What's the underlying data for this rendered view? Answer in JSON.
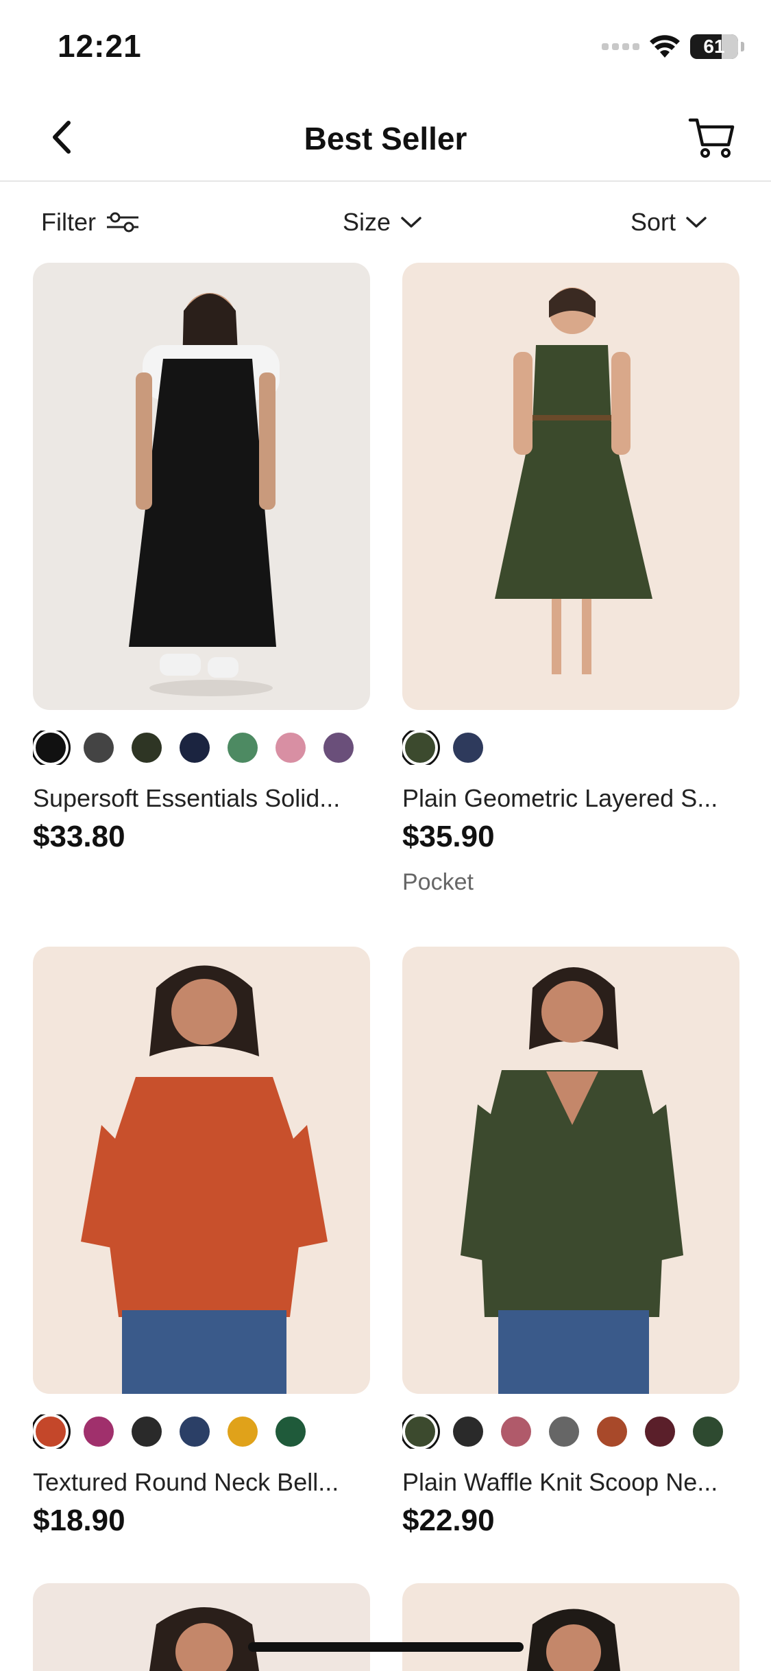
{
  "status": {
    "time": "12:21",
    "battery": "61"
  },
  "nav": {
    "title": "Best Seller"
  },
  "filters": {
    "filter_label": "Filter",
    "size_label": "Size",
    "sort_label": "Sort"
  },
  "products": [
    {
      "name": "Supersoft Essentials Solid...",
      "price": "$33.80",
      "tag": "",
      "bg": "#ece8e4",
      "swatches": [
        "#111111",
        "#444444",
        "#2e3524",
        "#1b2440",
        "#4d8a62",
        "#d88fa3",
        "#6a4f7a"
      ]
    },
    {
      "name": "Plain Geometric Layered S...",
      "price": "$35.90",
      "tag": "Pocket",
      "bg": "#f3e6dc",
      "swatches": [
        "#3c4a2e",
        "#2e3a5c"
      ]
    },
    {
      "name": "Textured Round Neck Bell...",
      "price": "$18.90",
      "tag": "",
      "bg": "#f3e6dc",
      "swatches": [
        "#c4472a",
        "#a0306c",
        "#2a2a2a",
        "#2b3f66",
        "#e0a21a",
        "#1f5a3a"
      ]
    },
    {
      "name": "Plain Waffle Knit Scoop Ne...",
      "price": "$22.90",
      "tag": "",
      "bg": "#f3e6dc",
      "swatches": [
        "#3c4a2e",
        "#2a2a2a",
        "#b05a6a",
        "#666666",
        "#a8492a",
        "#5a1f2a",
        "#2e4a30"
      ]
    }
  ]
}
